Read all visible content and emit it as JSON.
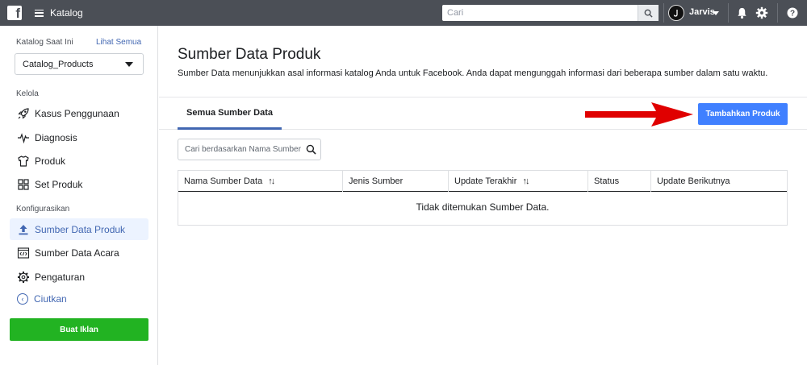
{
  "topbar": {
    "title": "Katalog",
    "search_placeholder": "Cari",
    "user_name": "Jarvis"
  },
  "sidebar": {
    "catalog_label": "Katalog Saat Ini",
    "catalog_link": "Lihat Semua",
    "catalog_selected": "Catalog_Products",
    "section_manage": "Kelola",
    "manage_items": [
      {
        "label": "Kasus Penggunaan",
        "icon": "rocket-icon"
      },
      {
        "label": "Diagnosis",
        "icon": "pulse-icon"
      },
      {
        "label": "Produk",
        "icon": "shirt-icon"
      },
      {
        "label": "Set Produk",
        "icon": "grid-icon"
      }
    ],
    "section_config": "Konfigurasikan",
    "config_items": [
      {
        "label": "Sumber Data Produk",
        "icon": "upload-icon",
        "active": true
      },
      {
        "label": "Sumber Data Acara",
        "icon": "code-icon",
        "active": false
      },
      {
        "label": "Pengaturan",
        "icon": "gear-icon",
        "active": false
      }
    ],
    "collapse_label": "Ciutkan",
    "ad_button": "Buat Iklan"
  },
  "main": {
    "title": "Sumber Data Produk",
    "description": "Sumber Data menunjukkan asal informasi katalog Anda untuk Facebook. Anda dapat mengunggah informasi dari beberapa sumber dalam satu waktu.",
    "tab_label": "Semua Sumber Data",
    "add_button": "Tambahkan Produk",
    "table_search_placeholder": "Cari berdasarkan Nama Sumber Data",
    "columns": [
      "Nama Sumber Data",
      "Jenis Sumber",
      "Update Terakhir",
      "Status",
      "Update Berikutnya"
    ],
    "empty_message": "Tidak ditemukan Sumber Data."
  },
  "colors": {
    "topbar": "#4b4f56",
    "accent": "#4080ff",
    "link": "#4267b2",
    "green": "#22b322",
    "arrow": "#e00000"
  }
}
